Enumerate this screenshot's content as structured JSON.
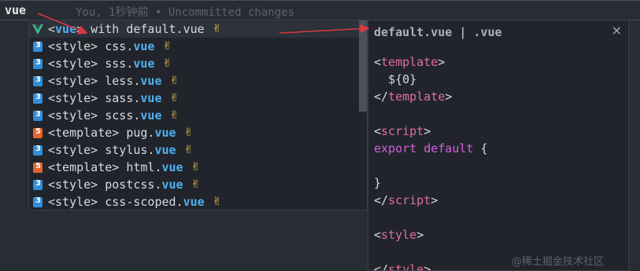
{
  "editor": {
    "typed": "vue",
    "blame": "You, 1秒钟前 • Uncommitted changes"
  },
  "suggestions": [
    {
      "icon": "vue",
      "prefix": "<",
      "hl": "vue",
      "mid": "> with default.vue",
      "hl2": "",
      "emoji": "✌"
    },
    {
      "icon": "css",
      "prefix": "<style> css.",
      "hl": "vue",
      "mid": "",
      "hl2": "",
      "emoji": "✌"
    },
    {
      "icon": "css",
      "prefix": "<style> sss.",
      "hl": "vue",
      "mid": "",
      "hl2": "",
      "emoji": "✌"
    },
    {
      "icon": "css",
      "prefix": "<style> less.",
      "hl": "vue",
      "mid": "",
      "hl2": "",
      "emoji": "✌"
    },
    {
      "icon": "css",
      "prefix": "<style> sass.",
      "hl": "vue",
      "mid": "",
      "hl2": "",
      "emoji": "✌"
    },
    {
      "icon": "css",
      "prefix": "<style> scss.",
      "hl": "vue",
      "mid": "",
      "hl2": "",
      "emoji": "✌"
    },
    {
      "icon": "html",
      "prefix": "<template> pug.",
      "hl": "vue",
      "mid": "",
      "hl2": "",
      "emoji": "✌"
    },
    {
      "icon": "css",
      "prefix": "<style> stylus.",
      "hl": "vue",
      "mid": "",
      "hl2": "",
      "emoji": "✌"
    },
    {
      "icon": "html",
      "prefix": "<template> html.",
      "hl": "vue",
      "mid": "",
      "hl2": "",
      "emoji": "✌"
    },
    {
      "icon": "css",
      "prefix": "<style> postcss.",
      "hl": "vue",
      "mid": "",
      "hl2": "",
      "emoji": "✌"
    },
    {
      "icon": "css",
      "prefix": "<style> css-scoped.",
      "hl": "vue",
      "mid": "",
      "hl2": "",
      "emoji": "✌"
    }
  ],
  "details": {
    "header": "default.vue | .vue",
    "close": "×",
    "code": [
      [
        {
          "c": "punc",
          "t": "<"
        },
        {
          "c": "tag",
          "t": "template"
        },
        {
          "c": "punc",
          "t": ">"
        }
      ],
      [
        {
          "c": "punc",
          "t": "  ${0}"
        }
      ],
      [
        {
          "c": "punc",
          "t": "</"
        },
        {
          "c": "tag",
          "t": "template"
        },
        {
          "c": "punc",
          "t": ">"
        }
      ],
      [],
      [
        {
          "c": "punc",
          "t": "<"
        },
        {
          "c": "tag",
          "t": "script"
        },
        {
          "c": "punc",
          "t": ">"
        }
      ],
      [
        {
          "c": "kw",
          "t": "export default "
        },
        {
          "c": "punc",
          "t": "{"
        }
      ],
      [],
      [
        {
          "c": "punc",
          "t": "}"
        }
      ],
      [
        {
          "c": "punc",
          "t": "</"
        },
        {
          "c": "tag",
          "t": "script"
        },
        {
          "c": "punc",
          "t": ">"
        }
      ],
      [],
      [
        {
          "c": "punc",
          "t": "<"
        },
        {
          "c": "tag",
          "t": "style"
        },
        {
          "c": "punc",
          "t": ">"
        }
      ],
      [],
      [
        {
          "c": "punc",
          "t": "</"
        },
        {
          "c": "tag",
          "t": "style"
        },
        {
          "c": "punc",
          "t": ">"
        }
      ]
    ]
  },
  "watermark": "@稀土掘金技术社区",
  "colors": {
    "background": "#282c34",
    "highlight": "#4fb0ef",
    "tag": "#e06c9f",
    "keyword": "#d55fde",
    "arrow": "#d9393e"
  }
}
